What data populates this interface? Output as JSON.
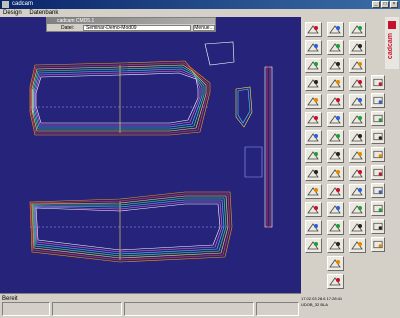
{
  "window": {
    "title": "cadcam"
  },
  "menu": [
    "Design",
    "Datenbank"
  ],
  "subwindow": {
    "title": "cadcam CMD5.1",
    "field_label": "Datei:",
    "field_value": "Seminar-Demo-Mod09",
    "menu_button": "Menue..."
  },
  "status": {
    "left_text": "Bereit",
    "info_line1": "17.02.03 28.6 17:28:41",
    "info_line2": "UDOB_32 BLA"
  },
  "logo": {
    "text": "cadcam"
  },
  "tools": [
    "tool-1",
    "tool-2",
    "tool-3",
    "tool-4",
    "tool-5",
    "tool-6",
    "tool-7",
    "tool-8",
    "tool-9",
    "tool-10",
    "tool-11",
    "tool-12",
    "tool-13",
    "tool-14",
    "tool-15",
    "tool-16",
    "tool-17",
    "tool-18"
  ]
}
